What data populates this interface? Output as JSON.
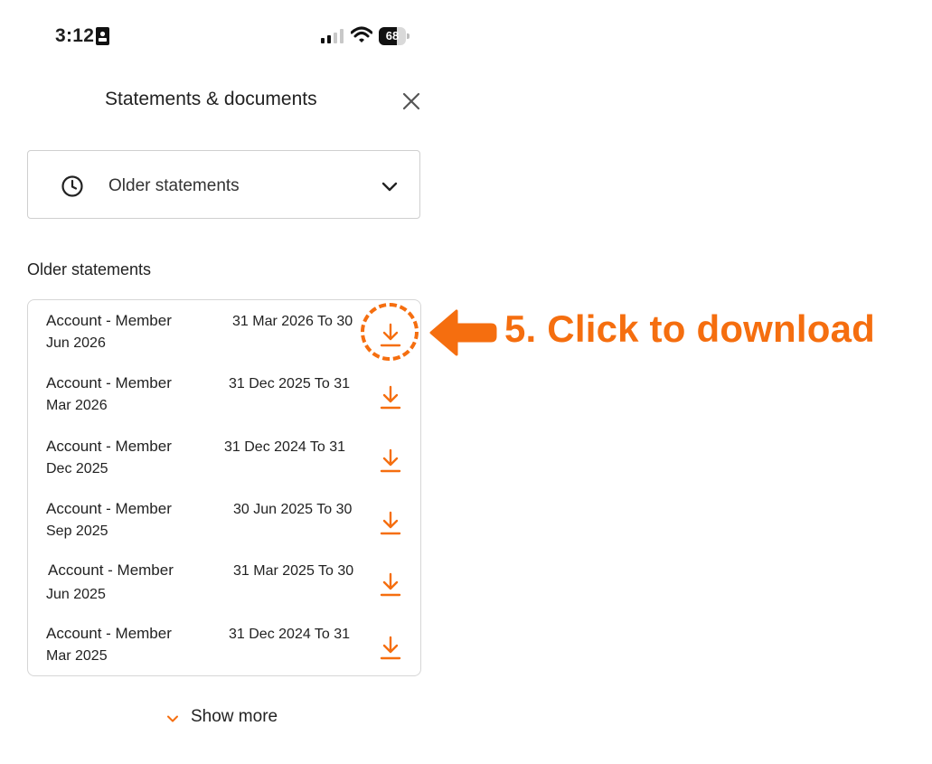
{
  "status_bar": {
    "time": "3:12",
    "battery_level": 68,
    "battery_text": "68",
    "icons": [
      "id-card-icon",
      "signal-icon",
      "wifi-icon",
      "battery-icon"
    ]
  },
  "header": {
    "title": "Statements & documents",
    "close_icon": "close-icon"
  },
  "dropdown": {
    "icon": "clock-icon",
    "value": "Older statements",
    "chevron_icon": "chevron-down-icon"
  },
  "section_label": "Older statements",
  "statements": [
    {
      "title": "Account - Member",
      "dates": "31 Mar 2026 To 30",
      "end": "Jun 2026"
    },
    {
      "title": "Account - Member",
      "dates": "31 Dec 2025 To 31",
      "end": "Mar 2026"
    },
    {
      "title": "Account - Member",
      "dates": "31 Dec 2024 To 31",
      "end": "Dec 2025"
    },
    {
      "title": "Account - Member",
      "dates": "30 Jun 2025 To 30",
      "end": "Sep 2025"
    },
    {
      "title": "Account - Member",
      "dates": "31 Mar 2025 To 30",
      "end": "Jun 2025"
    },
    {
      "title": "Account - Member",
      "dates": "31 Dec 2024 To 31",
      "end": "Mar 2025"
    }
  ],
  "show_more": {
    "label": "Show more",
    "icon": "chevron-down-icon"
  },
  "annotation": {
    "text": "5. Click to download",
    "arrow_icon": "arrow-left-icon"
  },
  "colors": {
    "accent": "#f56e0f",
    "text": "#222222",
    "border": "#d6d6d6"
  }
}
